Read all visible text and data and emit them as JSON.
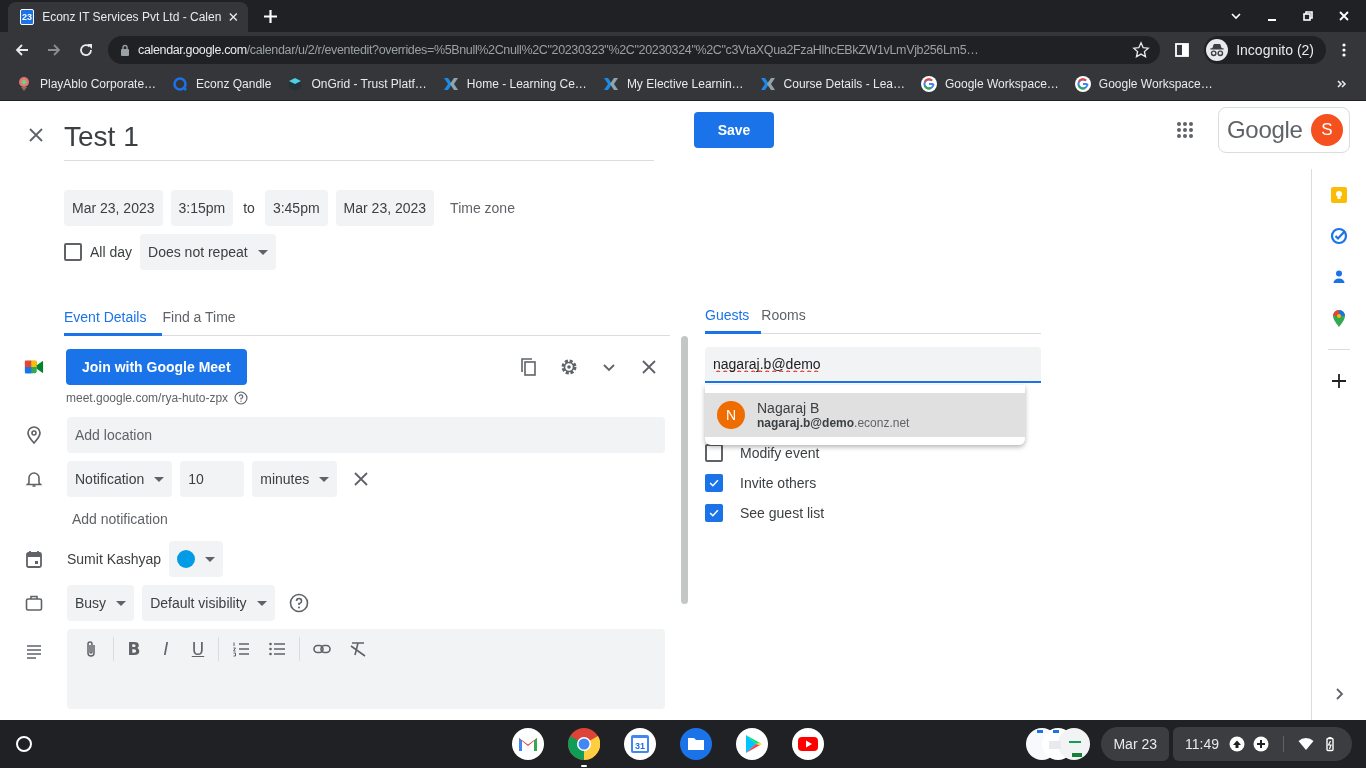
{
  "browser": {
    "tab": {
      "title": "Econz IT Services Pvt Ltd - Calen",
      "favicon_text": "23"
    },
    "url": {
      "host": "calendar.google.com",
      "path": "/calendar/u/2/r/eventedit?overrides=%5Bnull%2Cnull%2C\"20230323\"%2C\"20230324\"%2C\"c3VtaXQua2FzaHlhcEBkZW1vLmVjb256Lm5…"
    },
    "profile": "Incognito (2)",
    "bookmarks": [
      {
        "label": "PlayAblo Corporate…",
        "kind": "pin"
      },
      {
        "label": "Econz Qandle",
        "kind": "ring"
      },
      {
        "label": "OnGrid - Trust Platf…",
        "kind": "cube"
      },
      {
        "label": "Home - Learning Ce…",
        "kind": "cross"
      },
      {
        "label": "My Elective Learnin…",
        "kind": "cross"
      },
      {
        "label": "Course Details - Lea…",
        "kind": "cross"
      },
      {
        "label": "Google Workspace…",
        "kind": "g"
      },
      {
        "label": "Google Workspace…",
        "kind": "g"
      }
    ]
  },
  "event": {
    "title": "Test 1",
    "start_date": "Mar 23, 2023",
    "start_time": "3:15pm",
    "to": "to",
    "end_time": "3:45pm",
    "end_date": "Mar 23, 2023",
    "time_zone": "Time zone",
    "all_day": {
      "label": "All day",
      "checked": false
    },
    "repeat": "Does not repeat",
    "tabs": [
      {
        "label": "Event Details",
        "selected": true
      },
      {
        "label": "Find a Time",
        "selected": false
      }
    ],
    "meet": {
      "button": "Join with Google Meet",
      "link": "meet.google.com/rya-huto-zpx"
    },
    "location": {
      "placeholder": "Add location"
    },
    "notification": {
      "type": "Notification",
      "value": "10",
      "unit": "minutes"
    },
    "add_notification": "Add notification",
    "calendar": {
      "owner": "Sumit Kashyap",
      "color": "#039be5"
    },
    "availability": "Busy",
    "visibility": "Default visibility",
    "format_buttons": [
      {
        "label": "B",
        "kind": "bold"
      },
      {
        "label": "I",
        "kind": "italic"
      },
      {
        "label": "U",
        "kind": "underline"
      }
    ]
  },
  "save": "Save",
  "account": {
    "brand": "Google",
    "initial": "S"
  },
  "guests": {
    "tabs": [
      {
        "label": "Guests",
        "selected": true
      },
      {
        "label": "Rooms",
        "selected": false
      }
    ],
    "input": {
      "value": "nagaraj.b@demo"
    },
    "suggestion": {
      "name": "Nagaraj B",
      "email": "**nagaraj.b@demo**.econz.net",
      "initial": "N"
    },
    "permissions": [
      {
        "label": "Modify event",
        "checked": false
      },
      {
        "label": "Invite others",
        "checked": true
      },
      {
        "label": "See guest list",
        "checked": true
      }
    ]
  },
  "shelf": {
    "apps": [
      {
        "kind": "gmail"
      },
      {
        "kind": "chrome",
        "active": true
      },
      {
        "kind": "calendar",
        "text": "31"
      },
      {
        "kind": "files"
      },
      {
        "kind": "play"
      },
      {
        "kind": "youtube"
      }
    ],
    "date": "Mar 23",
    "time": "11:49"
  }
}
